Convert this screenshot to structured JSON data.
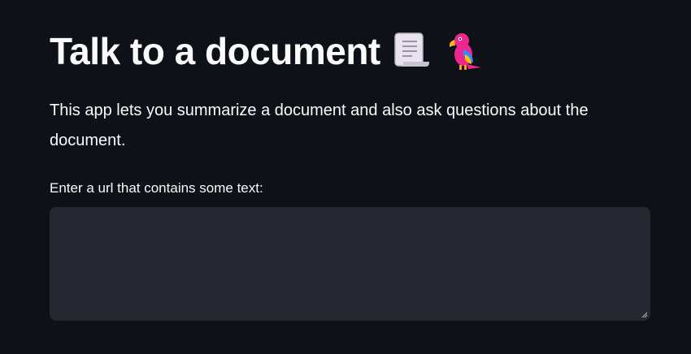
{
  "header": {
    "title": "Talk to a document",
    "icons": [
      "scroll-icon",
      "parrot-icon"
    ]
  },
  "body": {
    "description": "This app lets you summarize a document and also ask questions about the document."
  },
  "url_input": {
    "label": "Enter a url that contains some text:",
    "value": "",
    "placeholder": ""
  },
  "colors": {
    "background": "#0e1117",
    "text": "#fafafa",
    "input_background": "#262730"
  }
}
